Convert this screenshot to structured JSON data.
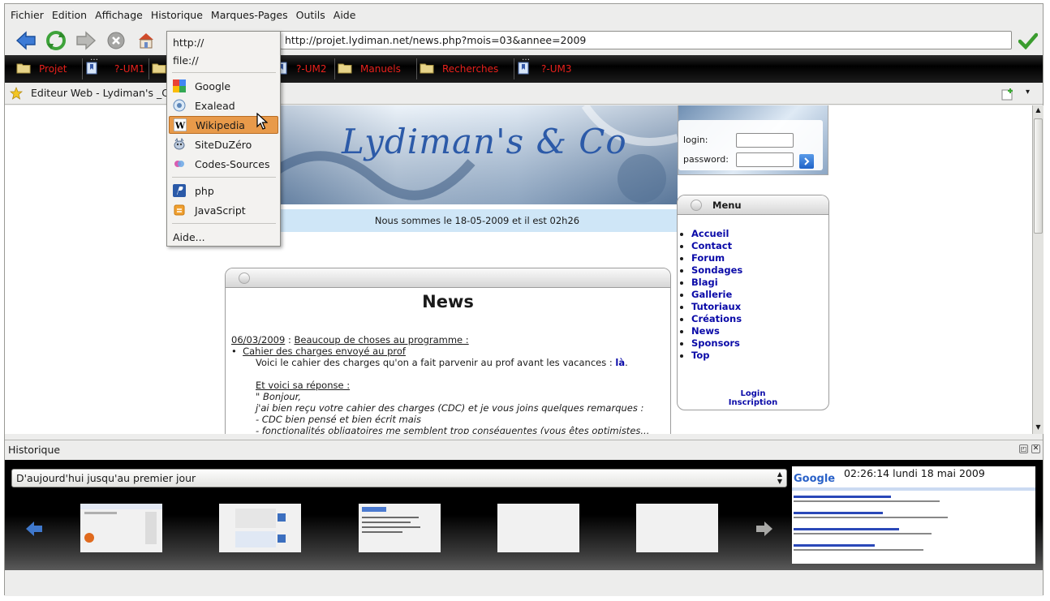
{
  "menubar": [
    "Fichier",
    "Edition",
    "Affichage",
    "Historique",
    "Marques-Pages",
    "Outils",
    "Aide"
  ],
  "toolbar": {
    "url": "http://projet.lydiman.net/news.php?mois=03&annee=2009",
    "icons": [
      "back-icon",
      "reload-icon",
      "forward-icon",
      "stop-icon",
      "home-icon",
      "go-icon"
    ]
  },
  "bookmarks": [
    {
      "label": "Projet",
      "icon": "folder-icon",
      "overflow": false
    },
    {
      "label": "?-UM1",
      "icon": "bookmark-icon",
      "overflow": true
    },
    {
      "label": "?-UM2",
      "icon": "bookmark-icon",
      "overflow": false
    },
    {
      "label": "Manuels",
      "icon": "folder-icon",
      "overflow": false
    },
    {
      "label": "Recherches",
      "icon": "folder-icon",
      "overflow": false
    },
    {
      "label": "?-UM3",
      "icon": "bookmark-icon",
      "overflow": true
    }
  ],
  "tab": {
    "title": "Editeur Web - Lydiman's _C"
  },
  "dropdown": {
    "items": [
      {
        "label": "http://",
        "icon": null
      },
      {
        "label": "file://",
        "icon": null
      },
      {
        "label": "Google",
        "icon": "google-icon"
      },
      {
        "label": "Exalead",
        "icon": "exalead-icon"
      },
      {
        "label": "Wikipedia",
        "icon": "wikipedia-icon"
      },
      {
        "label": "SiteDuZéro",
        "icon": "zozor-icon"
      },
      {
        "label": "Codes-Sources",
        "icon": "codes-sources-icon"
      },
      {
        "label": "php",
        "icon": "php-icon"
      },
      {
        "label": "JavaScript",
        "icon": "javascript-icon"
      },
      {
        "label": "Aide...",
        "icon": null
      }
    ],
    "highlighted": "Wikipedia"
  },
  "site": {
    "banner_title": "Lydiman's & Co",
    "date_line": "Nous sommes le 18-05-2009 et il est 02h26",
    "login_label": "login:",
    "password_label": "password:",
    "menu_title": "Menu",
    "menu_items": [
      "Accueil",
      "Contact",
      "Forum",
      "Sondages",
      "Blagi",
      "Gallerie",
      "Tutoriaux",
      "Créations",
      "News",
      "Sponsors",
      "Top"
    ],
    "login_link": "Login",
    "inscription_link": "Inscription",
    "news": {
      "title": "News",
      "date": "06/03/2009",
      "headline": "Beaucoup de choses au programme :",
      "bullet": "Cahier des charges envoyé au prof",
      "line1_text": "Voici le cahier des charges qu'on a fait parvenir au prof avant les vacances :",
      "line1_link": "là",
      "reply_heading": "Et voici sa réponse :",
      "quote": [
        "\" Bonjour,",
        "j'ai bien reçu votre cahier des charges (CDC) et je vous joins quelques remarques :",
        "- CDC bien pensé et bien écrit mais",
        "- fonctionalités obligatoires me semblent trop conséquentes (vous êtes optimistes..."
      ]
    }
  },
  "history": {
    "label": "Historique",
    "range_select": "D'aujourd'hui jusqu'au premier jour",
    "clock": "02:26:14 lundi 18 mai 2009",
    "thumb_count": 5
  },
  "colors": {
    "accent": "#e89a4a",
    "bookmark_text": "#e8211c",
    "link": "#0a0aa8"
  }
}
